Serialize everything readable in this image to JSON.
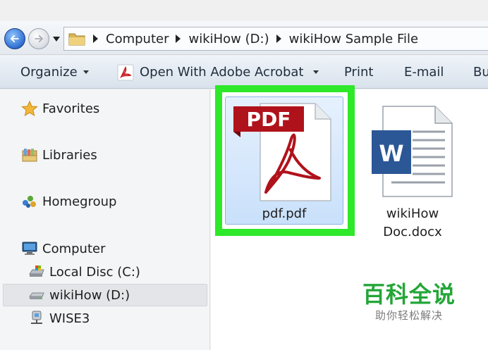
{
  "address": {
    "crumbs": [
      "Computer",
      "wikiHow (D:)",
      "wikiHow Sample File"
    ]
  },
  "toolbar": {
    "organize": "Organize",
    "open_with": "Open With Adobe Acrobat",
    "print": "Print",
    "email": "E-mail",
    "burn": "Bu"
  },
  "nav": {
    "favorites": "Favorites",
    "libraries": "Libraries",
    "homegroup": "Homegroup",
    "computer": "Computer",
    "local_disc": "Local Disc (C:)",
    "wikihow_drive": "wikiHow (D:)",
    "wise3": "WISE3"
  },
  "files": {
    "pdf": {
      "name": "pdf.pdf",
      "badge": "PDF"
    },
    "doc": {
      "name_line1": "wikiHow",
      "name_line2": "Doc.docx",
      "badge": "W"
    }
  },
  "colors": {
    "highlight": "#2ee82a",
    "pdf_red": "#b0121b",
    "word_blue": "#2b5797",
    "watermark_green": "#23a637"
  },
  "watermark": {
    "title": "百科全说",
    "subtitle": "助你轻松解决"
  }
}
